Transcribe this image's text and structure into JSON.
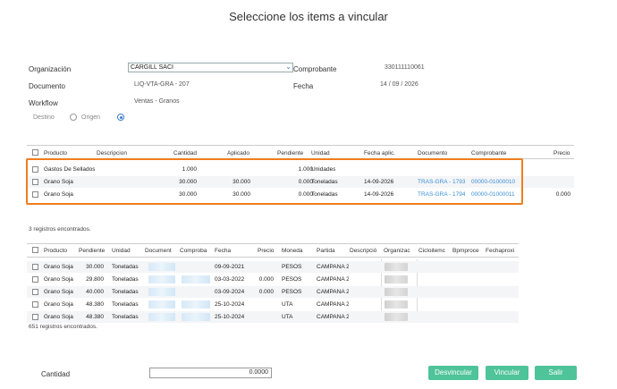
{
  "dialog": {
    "title": "Seleccione los items a vincular"
  },
  "form": {
    "organizacion_label": "Organización",
    "organizacion_value": "CARGILL SACI",
    "comprobante_label": "Comprobante",
    "comprobante_value": "330111110061",
    "documento_label": "Documento",
    "documento_value": "LIQ-VTA-GRA - 207",
    "fecha_label": "Fecha",
    "fecha_value": "14 / 09 / 2026",
    "workflow_label": "Workflow",
    "workflow_value": "Ventas - Granos",
    "destino_label": "Destino",
    "origen_label": "Origen",
    "selected_radio": "Destino"
  },
  "top_table": {
    "headers": [
      "Producto",
      "Descripcion",
      "Cantidad",
      "Aplicado",
      "Pendiente",
      "Unidad",
      "Fecha aplic.",
      "Documento",
      "Comprobante",
      "Precio"
    ],
    "rows": [
      [
        "Gastos De Sellados",
        "",
        "1.000",
        "",
        "1.000",
        "Unidades",
        "",
        "",
        "",
        ""
      ],
      [
        "Grano Soja",
        "",
        "30.000",
        "30.000",
        "0.000",
        "Toneladas",
        "14-09-2026",
        "TRAS-GRA - 1793",
        "00000-01000010",
        ""
      ],
      [
        "Grano Soja",
        "",
        "30.000",
        "30.000",
        "0.000",
        "Toneladas",
        "14-09-2026",
        "TRAS-GRA - 1794",
        "00000-01000011",
        "0.000"
      ]
    ],
    "count_text": "3 registros encontrados."
  },
  "bottom_table": {
    "headers": [
      "Producto",
      "Pendiente",
      "Unidad",
      "Document",
      "Comproba",
      "Fecha",
      "Precio",
      "Moneda",
      "Partida",
      "Descripció",
      "Organizac",
      "Cicloitemc",
      "Bpmproce",
      "Fechaproxi"
    ],
    "rows": [
      [
        "Grano Soja",
        "30.000",
        "Toneladas",
        "",
        "",
        "09-09-2021",
        "",
        "PESOS",
        "CAMPAÑA 2"
      ],
      [
        "Grano Soja",
        "29.800",
        "Toneladas",
        "",
        "",
        "03-03-2022",
        "0.000",
        "PESOS",
        "CAMPAÑA 2"
      ],
      [
        "Grano Soja",
        "40.000",
        "Toneladas",
        "",
        "",
        "03-09-2024",
        "0.000",
        "PESOS",
        "CAMPAÑA 2"
      ],
      [
        "Grano Soja",
        "48.380",
        "Toneladas",
        "",
        "",
        "25-10-2024",
        "",
        "UTA",
        "CAMPAÑA 2"
      ],
      [
        "Grano Soja",
        "48.380",
        "Toneladas",
        "",
        "",
        "25-10-2024",
        "",
        "UTA",
        "CAMPAÑA 2"
      ]
    ],
    "count_text": "651 registros encontrados."
  },
  "footer": {
    "cantidad_label": "Cantidad",
    "cantidad_value": "0.0000",
    "desvincular_label": "Desvincular",
    "vincular_label": "Vincular",
    "salir_label": "Salir"
  },
  "colors": {
    "accent": "#4fc39a",
    "link": "#3a8fd6",
    "highlight": "#f07d1e"
  }
}
